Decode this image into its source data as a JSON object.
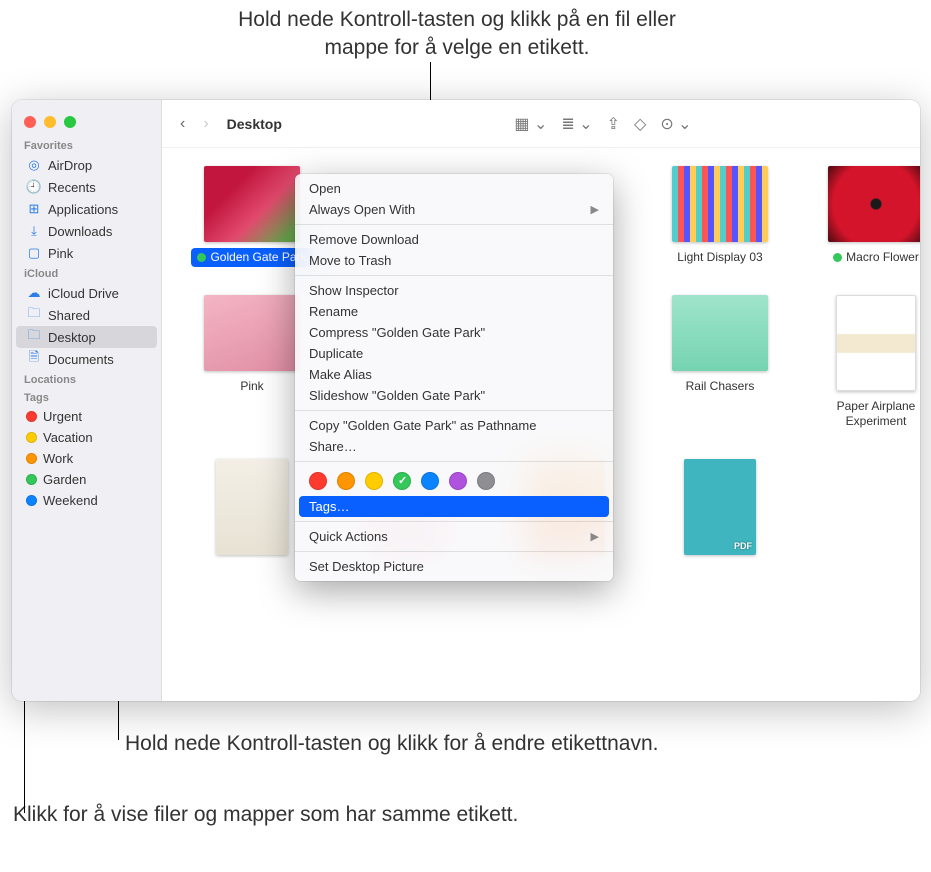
{
  "annotations": {
    "top": "Hold nede Kontroll-tasten og klikk på en fil eller mappe for å velge en etikett.",
    "mid": "Hold nede Kontroll-tasten og klikk for å endre etikettnavn.",
    "bot": "Klikk for å vise filer og mapper som har samme etikett."
  },
  "toolbar": {
    "title": "Desktop"
  },
  "sidebar": {
    "favorites_label": "Favorites",
    "icloud_label": "iCloud",
    "locations_label": "Locations",
    "tags_label": "Tags",
    "favorites": [
      {
        "label": "AirDrop",
        "icon": "airdrop"
      },
      {
        "label": "Recents",
        "icon": "clock"
      },
      {
        "label": "Applications",
        "icon": "apps"
      },
      {
        "label": "Downloads",
        "icon": "download"
      },
      {
        "label": "Pink",
        "icon": "folder"
      }
    ],
    "icloud": [
      {
        "label": "iCloud Drive",
        "icon": "cloud"
      },
      {
        "label": "Shared",
        "icon": "shared"
      },
      {
        "label": "Desktop",
        "icon": "desktop",
        "active": true
      },
      {
        "label": "Documents",
        "icon": "doc"
      }
    ],
    "tags": [
      {
        "label": "Urgent",
        "color": "#ff3b30"
      },
      {
        "label": "Vacation",
        "color": "#ffcc00"
      },
      {
        "label": "Work",
        "color": "#ff9500"
      },
      {
        "label": "Garden",
        "color": "#34c759"
      },
      {
        "label": "Weekend",
        "color": "#0a84ff"
      }
    ]
  },
  "files": [
    {
      "label": "Golden Gate Park",
      "selected": true,
      "tag_color": "#34c759"
    },
    {
      "label": "Light Display 03"
    },
    {
      "label": "Macro Flower",
      "tag_color": "#34c759"
    },
    {
      "label": "Pink"
    },
    {
      "label": "Rail Chasers"
    },
    {
      "label": "Paper Airplane Experiment"
    }
  ],
  "row3_files": [
    {
      "label": ""
    },
    {
      "label": ""
    },
    {
      "label": ""
    },
    {
      "label": ""
    }
  ],
  "context_menu": {
    "open": "Open",
    "always_open": "Always Open With",
    "remove_download": "Remove Download",
    "move_trash": "Move to Trash",
    "show_inspector": "Show Inspector",
    "rename": "Rename",
    "compress": "Compress \"Golden Gate Park\"",
    "duplicate": "Duplicate",
    "make_alias": "Make Alias",
    "slideshow": "Slideshow \"Golden Gate Park\"",
    "copy_path": "Copy \"Golden Gate Park\" as Pathname",
    "share": "Share…",
    "tags": "Tags…",
    "quick_actions": "Quick Actions",
    "set_desktop": "Set Desktop Picture",
    "tag_colors": [
      {
        "color": "#ff3b30"
      },
      {
        "color": "#ff9500"
      },
      {
        "color": "#ffcc00"
      },
      {
        "color": "#34c759",
        "checked": true
      },
      {
        "color": "#0a84ff"
      },
      {
        "color": "#af52de"
      },
      {
        "color": "#8e8e93"
      }
    ]
  }
}
